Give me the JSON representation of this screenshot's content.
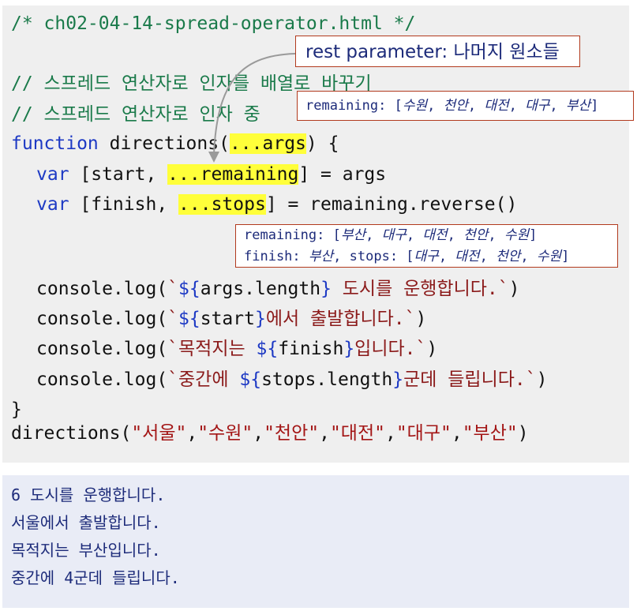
{
  "code": {
    "header_comment": "/* ch02-04-14-spread-operator.html */",
    "comment1": "// 스프레드 연산자로 인자를 배열로 바꾸기",
    "comment2": "// 스프레드 연산자로 인자 중",
    "fn_keyword": "function",
    "fn_sig_pre": " directions(",
    "fn_sig_hl": "...args",
    "fn_sig_post": ") {",
    "var_kw": "var",
    "line2_pre": " [start, ",
    "line2_hl": "...remaining",
    "line2_post": "] = args",
    "line3_pre": " [finish, ",
    "line3_hl": "...stops",
    "line3_post": "] = remaining.reverse()",
    "log_prefix": "console.log(",
    "log1_open": "`",
    "log1_interp_open": "${",
    "log1_expr": "args.length",
    "log1_interp_close": "}",
    "log1_text": " 도시를 운행합니다.`",
    "log2_open": "`",
    "log2_interp_open": "${",
    "log2_expr": "start",
    "log2_interp_close": "}",
    "log2_text": "에서 출발합니다.`",
    "log3_text1": "`목적지는 ",
    "log3_interp_open": "${",
    "log3_expr": "finish",
    "log3_interp_close": "}",
    "log3_text2": "입니다.`",
    "log4_text1": "`중간에 ",
    "log4_interp_open": "${",
    "log4_expr": "stops.length",
    "log4_interp_close": "}",
    "log4_text2": "군데 들립니다.`",
    "log_suffix": ")",
    "close_brace": "}",
    "call_name": "directions(",
    "call_args": [
      "\"서울\"",
      "\"수원\"",
      "\"천안\"",
      "\"대전\"",
      "\"대구\"",
      "\"부산\""
    ],
    "comma": ",",
    "call_close": ")"
  },
  "callouts": {
    "title": "rest parameter: 나머지 원소들",
    "remaining1_label": "remaining: [",
    "remaining1_items": [
      "수원",
      "천안",
      "대전",
      "대구",
      "부산"
    ],
    "remaining2_label": "remaining: [",
    "remaining2_items": [
      "부산",
      "대구",
      "대전",
      "천안",
      "수원"
    ],
    "finish_label": "finish: ",
    "finish_value": "부산",
    "stops_label": ", stops: [",
    "stops_items": [
      "대구",
      "대전",
      "천안",
      "수원"
    ],
    "sep": ", ",
    "close": "]"
  },
  "output": {
    "lines": [
      "6 도시를 운행합니다.",
      "서울에서 출발합니다.",
      "목적지는 부산입니다.",
      "중간에 4군데 들립니다."
    ]
  },
  "colors": {
    "keyword": "#1d39c4",
    "comment": "#1a7a4a",
    "string": "#a31515",
    "highlight": "#ffff3a",
    "callout_border": "#b23a1e",
    "output_text": "#1d2b7a"
  }
}
